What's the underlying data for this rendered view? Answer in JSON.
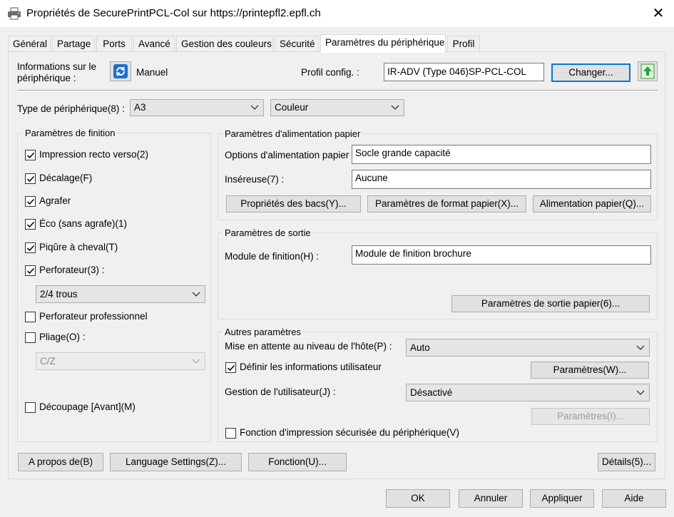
{
  "window": {
    "title": "Propriétés de SecurePrintPCL-Col sur https://printepfl2.epfl.ch",
    "close_glyph": "✕",
    "printer_icon": "printer-icon"
  },
  "tabs": [
    {
      "label": "Général"
    },
    {
      "label": "Partage"
    },
    {
      "label": "Ports"
    },
    {
      "label": "Avancé"
    },
    {
      "label": "Gestion des couleurs"
    },
    {
      "label": "Sécurité"
    },
    {
      "label": "Paramètres du périphérique"
    },
    {
      "label": "Profil"
    }
  ],
  "active_tab": "Paramètres du périphérique",
  "header": {
    "device_info_label": "Informations sur le\npériphérique :",
    "refresh_mode": "Manuel",
    "profile_label": "Profil config. :",
    "profile_value": "IR-ADV (Type 046)SP-PCL-COL",
    "change_button": "Changer..."
  },
  "device_type": {
    "label": "Type de périphérique(8) :",
    "value": "A3",
    "color_value": "Couleur"
  },
  "finishing": {
    "title": "Paramètres de finition",
    "items": [
      {
        "label": "Impression recto verso(2)",
        "checked": true
      },
      {
        "label": "Décalage(F)",
        "checked": true
      },
      {
        "label": "Agrafer",
        "checked": true
      },
      {
        "label": "Éco (sans agrafe)(1)",
        "checked": true
      },
      {
        "label": "Piqûre à cheval(T)",
        "checked": true
      },
      {
        "label": "Perforateur(3) :",
        "checked": true
      }
    ],
    "punch_value": "2/4 trous",
    "pro_punch": {
      "label": "Perforateur professionnel",
      "checked": false
    },
    "fold": {
      "label": "Pliage(O) :",
      "checked": false
    },
    "fold_value": "C/Z",
    "trim": {
      "label": "Découpage [Avant](M)",
      "checked": false
    }
  },
  "paper_source": {
    "title": "Paramètres d'alimentation papier",
    "options_label": "Options d'alimentation papier :",
    "options_value": "Socle grande capacité",
    "inserter_label": "Inséreuse(7) :",
    "inserter_value": "Aucune",
    "buttons": [
      "Propriétés des bacs(Y)...",
      "Paramètres de format papier(X)...",
      "Alimentation papier(Q)..."
    ]
  },
  "output": {
    "title": "Paramètres de sortie",
    "finisher_label": "Module de finition(H) :",
    "finisher_value": "Module de finition brochure",
    "output_button": "Paramètres de sortie papier(6)..."
  },
  "other": {
    "title": "Autres paramètres",
    "spool_label": "Mise en attente au niveau de l'hôte(P) :",
    "spool_value": "Auto",
    "user_info": {
      "label": "Définir les informations utilisateur",
      "checked": true
    },
    "params_button": "Paramètres(W)...",
    "user_mgmt_label": "Gestion de l'utilisateur(J) :",
    "user_mgmt_value": "Désactivé",
    "params_button_disabled": "Paramètres(I)...",
    "secure_print": {
      "label": "Fonction d'impression sécurisée du périphérique(V)",
      "checked": false
    }
  },
  "bottom_buttons": {
    "about": "A propos de(B)",
    "language": "Language Settings(Z)...",
    "function": "Fonction(U)...",
    "details": "Détails(5)..."
  },
  "dialog_buttons": {
    "ok": "OK",
    "cancel": "Annuler",
    "apply": "Appliquer",
    "help": "Aide"
  },
  "colors": {
    "accent": "#0078d7",
    "upload_icon_green": "#2e9e3e",
    "refresh_icon_blue": "#1e6fd0"
  }
}
